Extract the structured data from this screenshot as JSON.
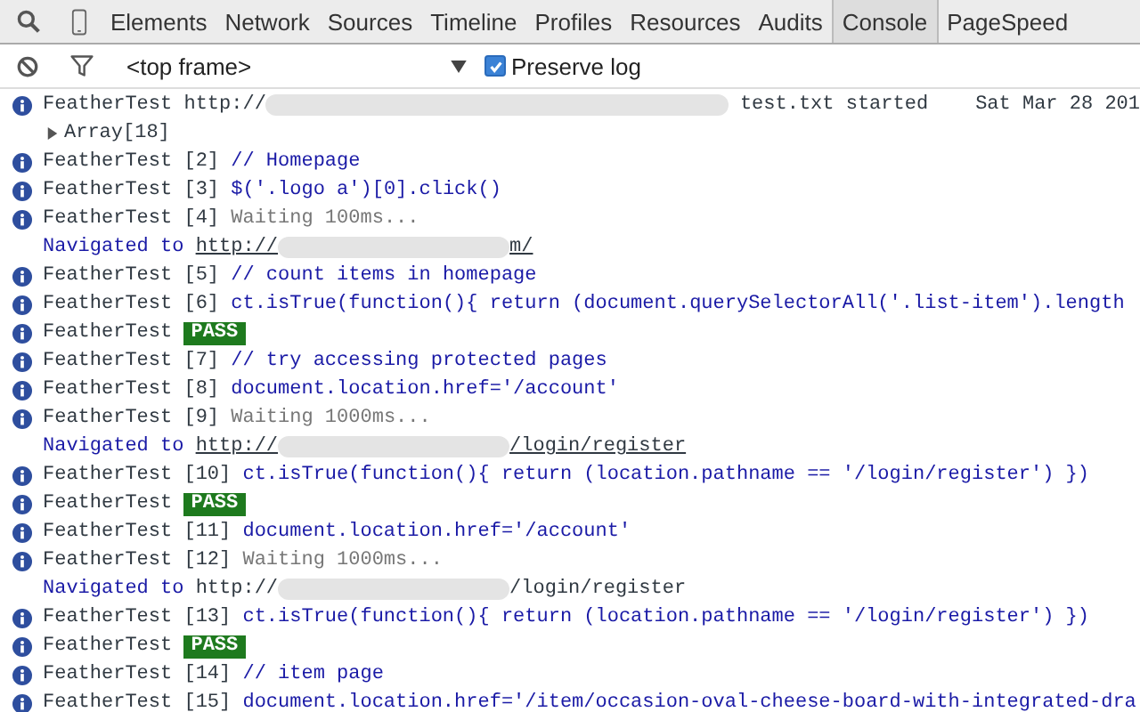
{
  "tabs": [
    {
      "label": "Elements",
      "selected": false
    },
    {
      "label": "Network",
      "selected": false
    },
    {
      "label": "Sources",
      "selected": false
    },
    {
      "label": "Timeline",
      "selected": false
    },
    {
      "label": "Profiles",
      "selected": false
    },
    {
      "label": "Resources",
      "selected": false
    },
    {
      "label": "Audits",
      "selected": false
    },
    {
      "label": "Console",
      "selected": true
    },
    {
      "label": "PageSpeed",
      "selected": false
    }
  ],
  "filter_bar": {
    "frame_select": "<top frame>",
    "preserve_log": {
      "label": "Preserve log",
      "checked": true
    }
  },
  "entries": [
    {
      "kind": "log",
      "source": "FeatherTest",
      "message": {
        "kind": "plain",
        "text": "http://"
      },
      "redacted": true,
      "message_after": "test.txt started",
      "timestamp": "Sat Mar 28 201"
    },
    {
      "kind": "object",
      "label": "Array[18]",
      "expanded": false
    },
    {
      "kind": "log",
      "source": "FeatherTest",
      "index": "[2]",
      "message": {
        "kind": "code",
        "text": "// Homepage"
      }
    },
    {
      "kind": "log",
      "source": "FeatherTest",
      "index": "[3]",
      "message": {
        "kind": "code",
        "text": "$('.logo a')[0].click()"
      }
    },
    {
      "kind": "log",
      "source": "FeatherTest",
      "index": "[4]",
      "message": {
        "kind": "muted",
        "text": "Waiting 100ms..."
      }
    },
    {
      "kind": "navigation",
      "label": "Navigated to",
      "url_start": "http://",
      "redacted": true,
      "url_end": "m/",
      "link": true
    },
    {
      "kind": "log",
      "source": "FeatherTest",
      "index": "[5]",
      "message": {
        "kind": "code",
        "text": "// count items in homepage"
      }
    },
    {
      "kind": "log",
      "source": "FeatherTest",
      "index": "[6]",
      "message": {
        "kind": "code",
        "text": "ct.isTrue(function(){ return (document.querySelectorAll('.list-item').length"
      }
    },
    {
      "kind": "log",
      "source": "FeatherTest",
      "message": {
        "kind": "pass",
        "text": "PASS"
      }
    },
    {
      "kind": "log",
      "source": "FeatherTest",
      "index": "[7]",
      "message": {
        "kind": "code",
        "text": "// try accessing protected pages"
      }
    },
    {
      "kind": "log",
      "source": "FeatherTest",
      "index": "[8]",
      "message": {
        "kind": "code",
        "text": "document.location.href='/account'"
      }
    },
    {
      "kind": "log",
      "source": "FeatherTest",
      "index": "[9]",
      "message": {
        "kind": "muted",
        "text": "Waiting 1000ms..."
      }
    },
    {
      "kind": "navigation",
      "label": "Navigated to",
      "url_start": "http://",
      "redacted": true,
      "url_end": "/login/register",
      "link": true
    },
    {
      "kind": "log",
      "source": "FeatherTest",
      "index": "[10]",
      "message": {
        "kind": "code",
        "text": "ct.isTrue(function(){ return (location.pathname == '/login/register') })"
      }
    },
    {
      "kind": "log",
      "source": "FeatherTest",
      "message": {
        "kind": "pass",
        "text": "PASS"
      }
    },
    {
      "kind": "log",
      "source": "FeatherTest",
      "index": "[11]",
      "message": {
        "kind": "code",
        "text": "document.location.href='/account'"
      }
    },
    {
      "kind": "log",
      "source": "FeatherTest",
      "index": "[12]",
      "message": {
        "kind": "muted",
        "text": "Waiting 1000ms..."
      }
    },
    {
      "kind": "navigation",
      "label": "Navigated to",
      "url_start": "http://",
      "redacted": true,
      "url_end": "/login/register",
      "link": false
    },
    {
      "kind": "log",
      "source": "FeatherTest",
      "index": "[13]",
      "message": {
        "kind": "code",
        "text": "ct.isTrue(function(){ return (location.pathname == '/login/register') })"
      }
    },
    {
      "kind": "log",
      "source": "FeatherTest",
      "message": {
        "kind": "pass",
        "text": "PASS"
      }
    },
    {
      "kind": "log",
      "source": "FeatherTest",
      "index": "[14]",
      "message": {
        "kind": "code",
        "text": "// item page"
      }
    },
    {
      "kind": "log",
      "source": "FeatherTest",
      "index": "[15]",
      "message": {
        "kind": "code",
        "text": "document.location.href='/item/occasion-oval-cheese-board-with-integrated-dra"
      }
    }
  ]
}
